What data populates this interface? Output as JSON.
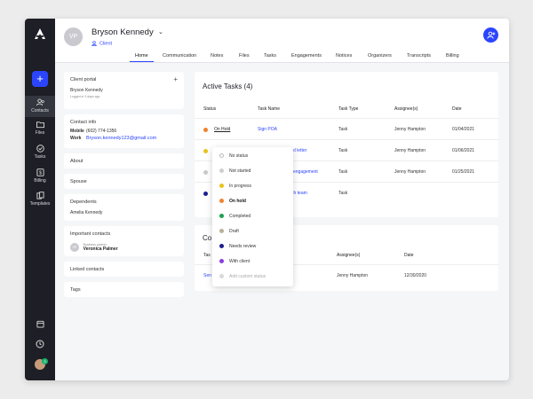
{
  "header": {
    "avatar_initials": "VP",
    "client_name": "Bryson Kennedy",
    "client_type": "Client",
    "tabs": [
      {
        "label": "Home"
      },
      {
        "label": "Communication"
      },
      {
        "label": "Notes"
      },
      {
        "label": "Files"
      },
      {
        "label": "Tasks"
      },
      {
        "label": "Engagements"
      },
      {
        "label": "Notices"
      },
      {
        "label": "Organizers"
      },
      {
        "label": "Transcripts"
      },
      {
        "label": "Billing"
      }
    ]
  },
  "nav": {
    "items": [
      {
        "label": "Contacts"
      },
      {
        "label": "Files"
      },
      {
        "label": "Tasks"
      },
      {
        "label": "Billing"
      },
      {
        "label": "Templates"
      }
    ],
    "badge": "3"
  },
  "side": {
    "client_portal": {
      "title": "Client portal",
      "name": "Bryson Kennedy",
      "note": "Logged in 3 days ago"
    },
    "contact_info": {
      "title": "Contact info",
      "mobile_label": "Mobile",
      "mobile": "(602) 774-1356",
      "work_label": "Work",
      "email": "Bryson.kennedy123@gmail.com"
    },
    "about": "About",
    "spouse": "Spouse",
    "dependents": {
      "title": "Dependents",
      "name": "Amelia Kennedy"
    },
    "important_contacts": {
      "title": "Important contacts",
      "initials": "VP",
      "role": "Business partner",
      "name": "Veronica Palmer"
    },
    "linked_contacts": "Linked contacts",
    "tags": "Tags"
  },
  "active_tasks": {
    "title": "Active Tasks (4)",
    "columns": [
      "Status",
      "Task Name",
      "Task Type",
      "Assignee(s)",
      "Date"
    ],
    "rows": [
      {
        "status": "On Hold",
        "status_color": "#f0822f",
        "name": "Sign POA",
        "type": "Task",
        "assignee": "Jenny Hampton",
        "date": "01/04/2021"
      },
      {
        "status": "",
        "status_color": "#e8c31c",
        "name": "d letter",
        "type": "Task",
        "assignee": "Jenny Hampton",
        "date": "01/06/2021"
      },
      {
        "status": "",
        "status_color": "#c8c8c8",
        "name": "engagement",
        "type": "Task",
        "assignee": "Jenny Hampton",
        "date": "01/25/2021"
      },
      {
        "status": "",
        "status_color": "#1d1f8f",
        "name": "ith team",
        "type": "Task",
        "assignee": "",
        "date": ""
      }
    ]
  },
  "completed_tasks": {
    "title": "Co",
    "columns": [
      "Tas",
      "Assignee(s)",
      "Date"
    ],
    "rows": [
      {
        "name": "Sen",
        "assignee": "Jenny Hampton",
        "date": "12/30/2020"
      }
    ]
  },
  "status_dropdown": {
    "options": [
      {
        "label": "No status",
        "color": "#ffffff",
        "state": "empty"
      },
      {
        "label": "Not started",
        "color": "#cfcfcf",
        "state": ""
      },
      {
        "label": "In progress",
        "color": "#e8c31c",
        "state": ""
      },
      {
        "label": "On hold",
        "color": "#f0822f",
        "state": "selected"
      },
      {
        "label": "Completed",
        "color": "#1aa34a",
        "state": ""
      },
      {
        "label": "Draft",
        "color": "#b9b19a",
        "state": ""
      },
      {
        "label": "Needs review",
        "color": "#1d1f8f",
        "state": ""
      },
      {
        "label": "With client",
        "color": "#8a3fe0",
        "state": ""
      },
      {
        "label": "Add custom status",
        "color": "#d9d9d9",
        "state": "muted"
      }
    ]
  },
  "colors": {
    "accent": "#2b45ff",
    "rail": "#1e1f26"
  }
}
